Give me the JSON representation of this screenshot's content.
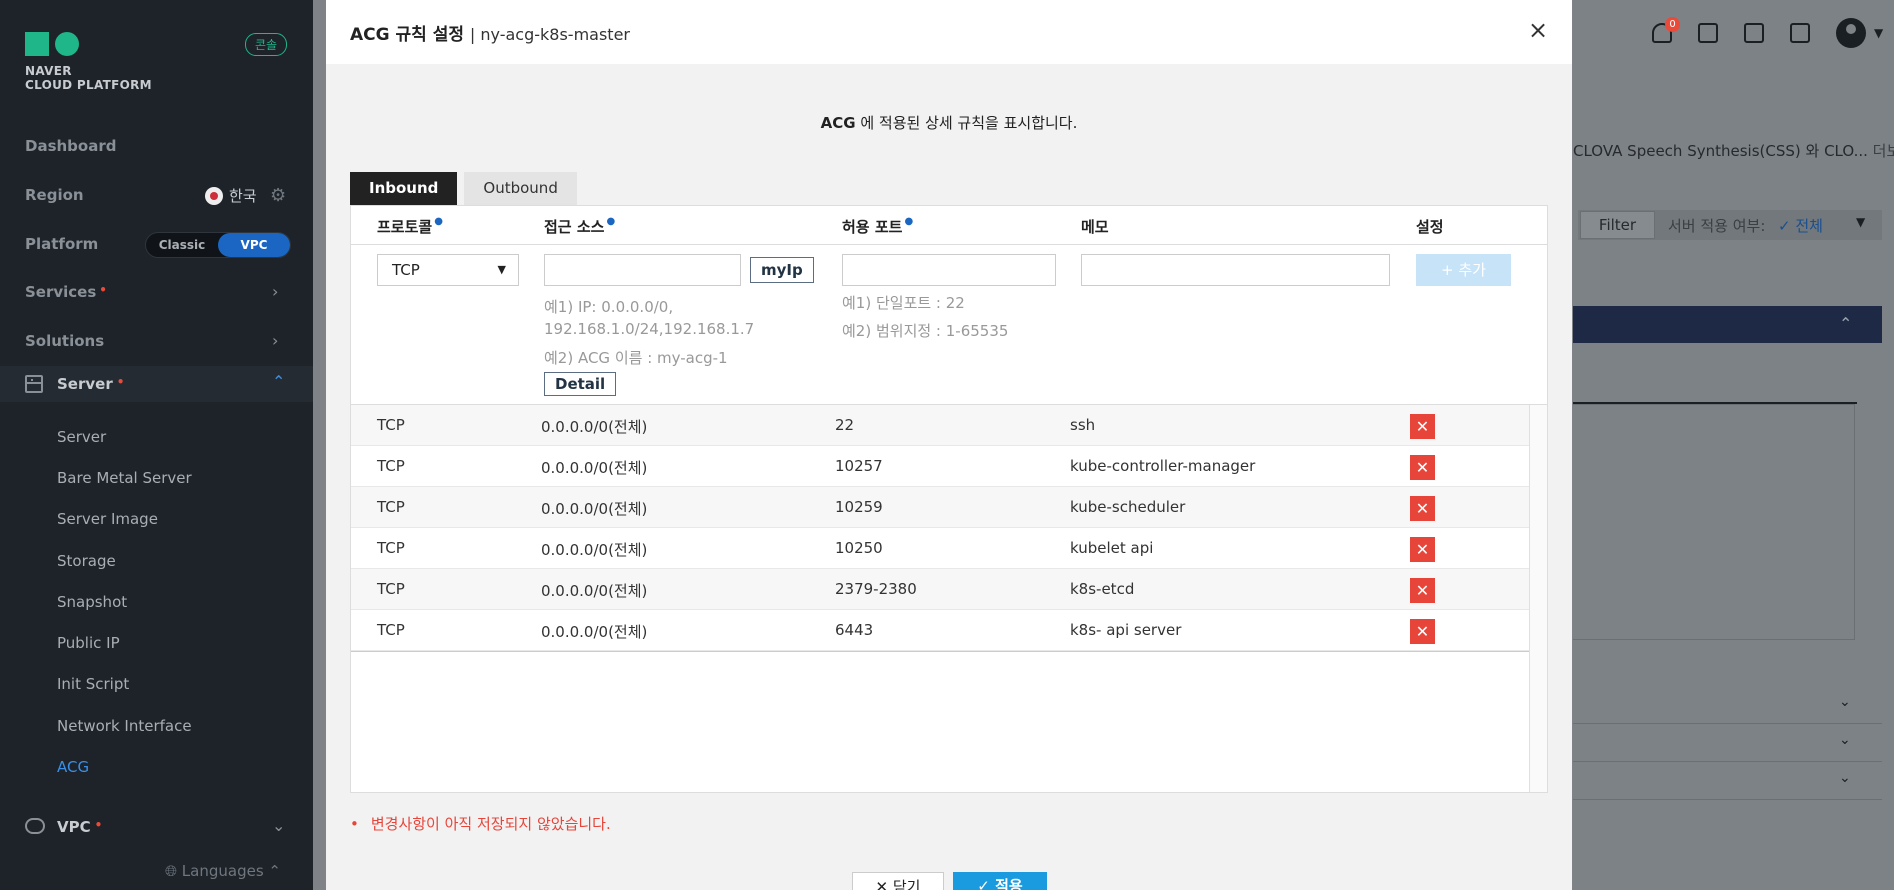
{
  "sidebar": {
    "logo_line1": "NAVER",
    "logo_line2": "CLOUD PLATFORM",
    "console_badge": "콘솔",
    "dashboard": "Dashboard",
    "region_label": "Region",
    "region_value": "한국",
    "platform_label": "Platform",
    "platform_options": [
      "Classic",
      "VPC"
    ],
    "platform_selected": "VPC",
    "services": "Services",
    "solutions": "Solutions",
    "server_group": "Server",
    "server_items": [
      "Server",
      "Bare Metal Server",
      "Server Image",
      "Storage",
      "Snapshot",
      "Public IP",
      "Init Script",
      "Network Interface",
      "ACG"
    ],
    "server_active": "ACG",
    "vpc": "VPC",
    "languages": "Languages"
  },
  "background": {
    "notification_count": "0",
    "notice_text": "CLOVA Speech Synthesis(CSS) 와 CLO...",
    "more_link": "더보기",
    "filter_button": "Filter",
    "filter_label": "서버 적용 여부:",
    "filter_value": "✓ 전체"
  },
  "modal": {
    "title": "ACG 규칙 설정",
    "subtitle": "ny-acg-k8s-master",
    "description_bold": "ACG",
    "description_rest": " 에 적용된 상세 규칙을 표시합니다.",
    "tabs": [
      "Inbound",
      "Outbound"
    ],
    "active_tab": "Inbound",
    "headers": {
      "protocol": "프로토콜",
      "source": "접근 소스",
      "port": "허용 포트",
      "memo": "메모",
      "settings": "설정"
    },
    "form": {
      "protocol_value": "TCP",
      "source_value": "",
      "port_value": "",
      "memo_value": "",
      "myip_button": "myIp",
      "source_hint1": "예1) IP: 0.0.0.0/0,",
      "source_hint2": "192.168.1.0/24,192.168.1.7",
      "source_hint3": "예2) ACG 이름 : my-acg-1",
      "detail_button": "Detail",
      "port_hint1": "예1) 단일포트 : 22",
      "port_hint2": "예2) 범위지정 : 1-65535",
      "add_button": "+ 추가"
    },
    "rules": [
      {
        "protocol": "TCP",
        "source": "0.0.0.0/0(전체)",
        "port": "22",
        "memo": "ssh"
      },
      {
        "protocol": "TCP",
        "source": "0.0.0.0/0(전체)",
        "port": "10257",
        "memo": "kube-controller-manager"
      },
      {
        "protocol": "TCP",
        "source": "0.0.0.0/0(전체)",
        "port": "10259",
        "memo": "kube-scheduler"
      },
      {
        "protocol": "TCP",
        "source": "0.0.0.0/0(전체)",
        "port": "10250",
        "memo": "kubelet api"
      },
      {
        "protocol": "TCP",
        "source": "0.0.0.0/0(전체)",
        "port": "2379-2380",
        "memo": "k8s-etcd"
      },
      {
        "protocol": "TCP",
        "source": "0.0.0.0/0(전체)",
        "port": "6443",
        "memo": "k8s- api server"
      }
    ],
    "delete_icon": "✕",
    "unsaved_warning": "변경사항이 아직 저장되지 않았습니다.",
    "close_button": "✕ 닫기",
    "apply_button": "✓ 적용"
  },
  "colors": {
    "sidebar_bg": "#1d2329",
    "brand_green": "#1fb68a",
    "accent_blue": "#1a66c2",
    "delete_red": "#e8453a",
    "apply_blue": "#1a9be0"
  }
}
